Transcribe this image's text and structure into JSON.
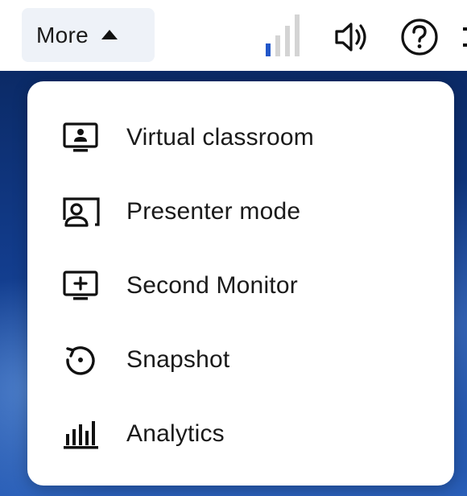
{
  "toolbar": {
    "more_label": "More",
    "icons": {
      "signal": "network-signal-icon",
      "speaker": "speaker-icon",
      "help": "help-icon",
      "caret": "caret-up-icon"
    },
    "signal_level": 1,
    "signal_max": 4
  },
  "menu": {
    "items": [
      {
        "label": "Virtual classroom",
        "icon": "virtual-classroom-icon"
      },
      {
        "label": "Presenter mode",
        "icon": "presenter-mode-icon"
      },
      {
        "label": "Second Monitor",
        "icon": "second-monitor-icon"
      },
      {
        "label": "Snapshot",
        "icon": "snapshot-icon"
      },
      {
        "label": "Analytics",
        "icon": "analytics-icon"
      }
    ]
  },
  "colors": {
    "signal_active": "#2257c9",
    "signal_inactive": "#d4d4d4",
    "more_button_bg": "#eef2f8",
    "text": "#1a1a1a"
  }
}
